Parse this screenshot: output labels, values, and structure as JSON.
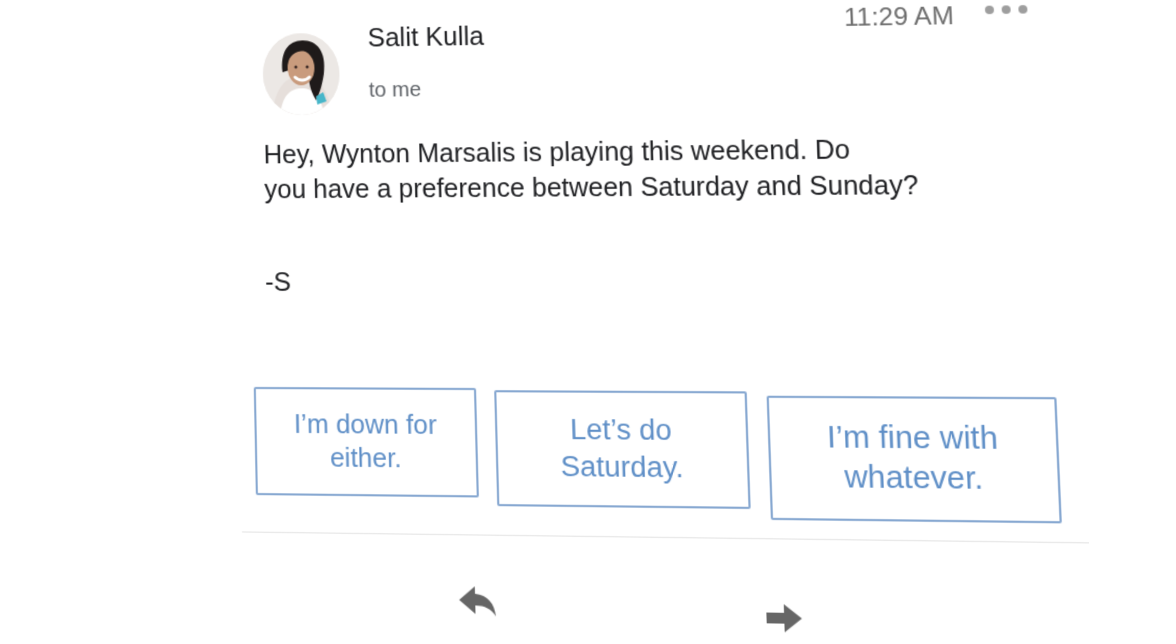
{
  "email": {
    "sender": "Salit Kulla",
    "recipient": "to me",
    "time": "11:29 AM",
    "body_lines": [
      "Hey, Wynton Marsalis is playing this weekend. Do",
      "you have a preference between Saturday and Sunday?"
    ],
    "signature": "-S"
  },
  "smart_replies": [
    {
      "line1": "I’m down for",
      "line2": "either."
    },
    {
      "line1": "Let’s do",
      "line2": "Saturday."
    },
    {
      "line1": "I’m fine with",
      "line2": "whatever."
    }
  ],
  "icons": {
    "more": "more-horizontal-icon",
    "reply": "reply-icon",
    "forward": "forward-icon"
  },
  "colors": {
    "chip_border": "#87a8d1",
    "chip_text": "#5f8fc7",
    "icon": "#666666"
  }
}
